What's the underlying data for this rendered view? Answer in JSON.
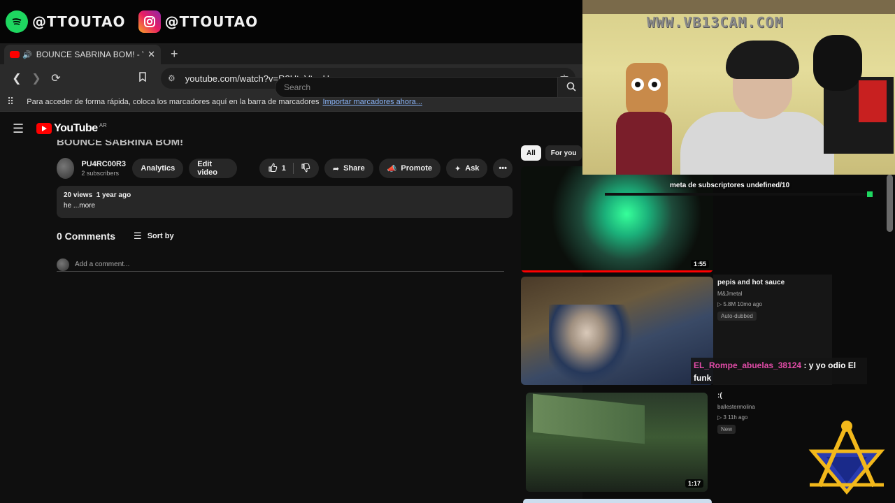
{
  "overlay": {
    "spotify_handle": "@TTOUTAO",
    "instagram_handle": "@TTOUTAO",
    "cam_site": "WWW.VB13CAM.COM",
    "subs_goal": "meta de subscriptores undefined/10",
    "chat": {
      "user": "EL_Rompe_abuelas_38124",
      "message": ": y yo odio El funk"
    }
  },
  "browser": {
    "tab_title": "BOUNCE SABRINA BOM! - YouTube",
    "url": "youtube.com/watch?v=R3UtpVtggUo",
    "bookmarks_text": "Para acceder de forma rápida, coloca los marcadores aquí en la barra de marcadores",
    "bookmarks_link": "Importar marcadores ahora..."
  },
  "youtube": {
    "logo": "YouTube",
    "region": "AR",
    "search_placeholder": "Search",
    "video_title": "BOUNCE SABRINA BOM!",
    "channel_name": "PU4RC00R3",
    "subscribers": "2 subscribers",
    "buttons": {
      "analytics": "Analytics",
      "edit_video": "Edit video",
      "likes": "1",
      "share": "Share",
      "promote": "Promote",
      "ask": "Ask"
    },
    "description": {
      "views": "20 views",
      "age": "1 year ago",
      "text": "he ...more"
    },
    "comments": {
      "count": "0 Comments",
      "sort": "Sort by",
      "placeholder": "Add a comment..."
    },
    "chips": [
      "All",
      "For you"
    ],
    "recommended": [
      {
        "duration": "1:55"
      },
      {
        "title": "pepis and hot sauce",
        "channel": "M&Jmetal",
        "stats": "▷ 5.8M  10mo ago",
        "badge": "Auto-dubbed"
      },
      {
        "title": ":(",
        "channel": "ballestermolina",
        "stats": "▷ 3  11h ago",
        "badge": "New",
        "duration": "1:17"
      }
    ]
  },
  "icons": {
    "spotify": "spotify-icon",
    "instagram": "instagram-icon",
    "back": "arrow-left-icon",
    "forward": "arrow-right-icon",
    "reload": "reload-icon",
    "bookmark": "bookmark-icon",
    "menu": "hamburger-icon",
    "search": "search-icon",
    "like": "thumbs-up-icon",
    "dislike": "thumbs-down-icon",
    "more": "more-icon"
  },
  "colors": {
    "youtube_red": "#ff0000",
    "spotify_green": "#1ed760",
    "chat_user": "#e24ca8",
    "link": "#8ab4f8"
  }
}
